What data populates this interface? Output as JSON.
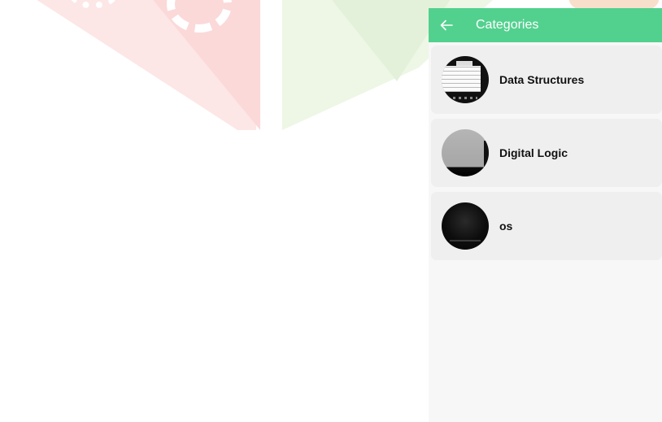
{
  "appbar": {
    "title": "Categories",
    "back_icon": "arrow-left-icon",
    "color": "#52d18e"
  },
  "categories": [
    {
      "label": "Data Structures",
      "thumb": "document-table-thumbnail"
    },
    {
      "label": "Digital Logic",
      "thumb": "gray-photo-thumbnail"
    },
    {
      "label": "os",
      "thumb": "dark-photo-thumbnail"
    }
  ]
}
